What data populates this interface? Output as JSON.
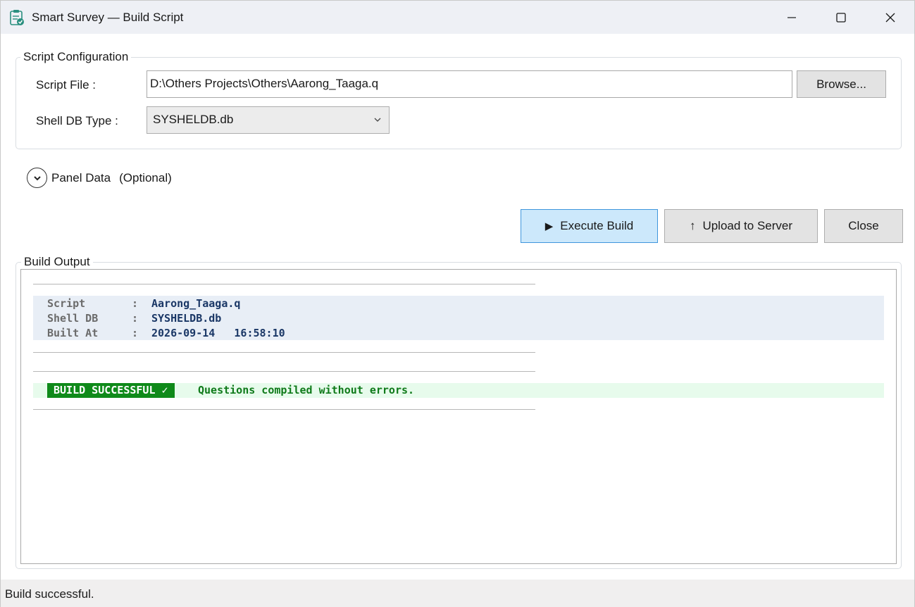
{
  "window": {
    "title": "Smart Survey — Build Script",
    "app_icon": "clipboard-check-icon"
  },
  "config": {
    "group_title": "Script Configuration",
    "script_file_label": "Script File :",
    "script_file_value": "D:\\Others Projects\\Others\\Aarong_Taaga.q",
    "browse_label": "Browse...",
    "shell_db_label": "Shell DB Type :",
    "shell_db_value": "SYSHELDB.db"
  },
  "panel_data": {
    "label": "Panel Data",
    "optional": "(Optional)"
  },
  "actions": {
    "execute_icon": "▶",
    "execute_label": "Execute Build",
    "upload_icon": "↑",
    "upload_label": "Upload to Server",
    "close_label": "Close"
  },
  "output": {
    "group_title": "Build Output",
    "info": [
      {
        "key": "Script",
        "colon": ":",
        "value": "Aarong_Taaga.q"
      },
      {
        "key": "Shell DB",
        "colon": ":",
        "value": "SYSHELDB.db"
      },
      {
        "key": "Built At",
        "colon": ":",
        "value": "2026-09-14   16:58:10"
      }
    ],
    "badge": "BUILD SUCCESSFUL ✓",
    "message": "Questions compiled without errors."
  },
  "status": {
    "text": "Build successful."
  },
  "colors": {
    "primary_button": "#cce8fb",
    "success": "#0f8a1a",
    "info_value": "#1a3766"
  }
}
